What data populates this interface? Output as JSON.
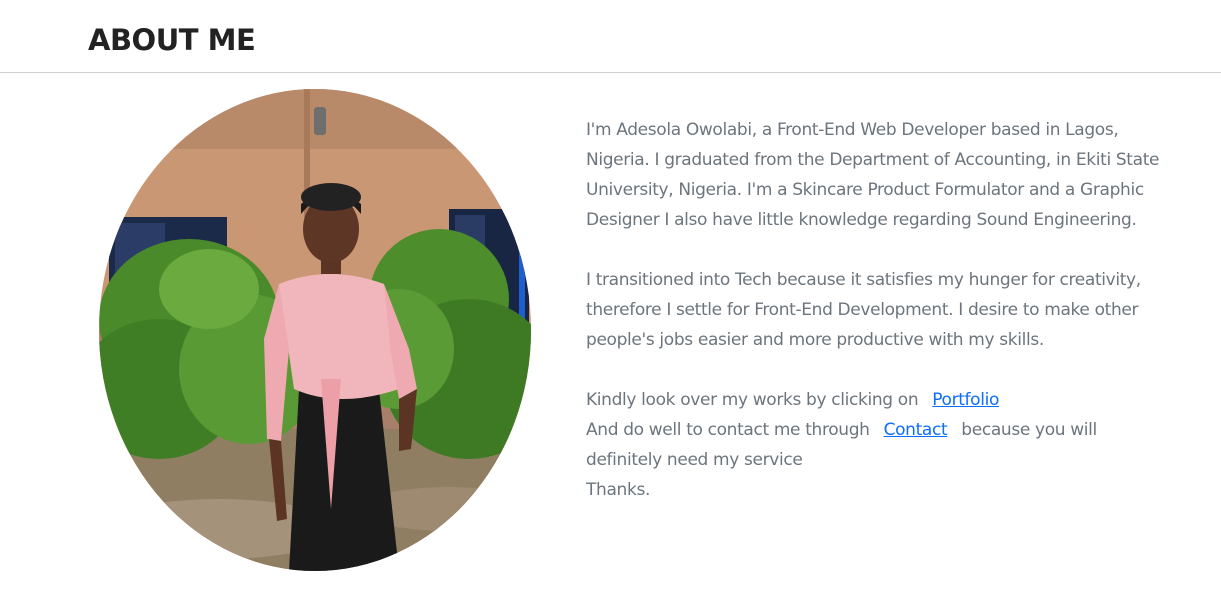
{
  "header": {
    "title": "ABOUT ME"
  },
  "profile_photo": {
    "icon": "profile-photo",
    "colors": {
      "wall": "#c79471",
      "shrub": "#4f8f2e",
      "blouse": "#f2b9bd",
      "skirt": "#1b1b1b",
      "ground": "#9a8a6e"
    }
  },
  "bio": {
    "paragraph_1": "I'm Adesola Owolabi, a Front-End Web Developer based in Lagos, Nigeria. I graduated from the Department of Accounting, in Ekiti State University, Nigeria. I'm a Skincare Product Formulator and a Graphic Designer I also have little knowledge regarding Sound Engineering.",
    "paragraph_2": "I transitioned into Tech because it satisfies my hunger for creativity, therefore I settle for Front-End Development. I desire to make other people's jobs easier and more productive with my skills.",
    "works_prefix": "Kindly look over my works by clicking on",
    "portfolio_link": "Portfolio",
    "contact_prefix": "And do well to contact me through",
    "contact_link": "Contact",
    "contact_suffix": "because you will definitely need my service",
    "thanks": "Thanks.",
    "link_color": "#0d6efd",
    "text_color": "#6c757d"
  }
}
